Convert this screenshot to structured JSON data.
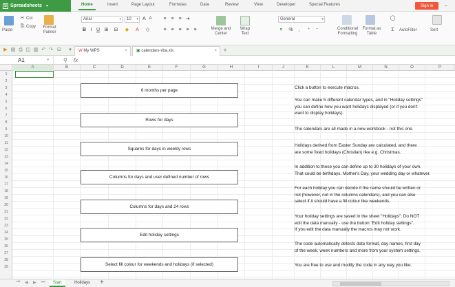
{
  "app": {
    "name": "Spreadsheets"
  },
  "menu": [
    "Home",
    "Insert",
    "Page Layout",
    "Formulas",
    "Data",
    "Review",
    "View",
    "Developer",
    "Special Features"
  ],
  "signin_label": "Sign in",
  "ribbon": {
    "cut": "Cut",
    "paste": "Paste",
    "copy": "Copy",
    "format_painter": "Format Painter",
    "font": "Arial",
    "size": "10",
    "merge": "Merge and Center",
    "wrap": "Wrap Text",
    "number_format": "General",
    "conditional": "Conditional Formatting",
    "format_table": "Format as Table",
    "autofilter": "AutoFilter",
    "sort": "Sort"
  },
  "tabs": {
    "home": "My WPS",
    "file": "calendars-vba.xls"
  },
  "formula": {
    "cell_ref": "A1",
    "fx": "fx"
  },
  "columns": [
    "A",
    "B",
    "C",
    "D",
    "E",
    "F",
    "G",
    "H",
    "I",
    "J",
    "K",
    "L",
    "M",
    "N",
    "O",
    "P"
  ],
  "rows": [
    "1",
    "2",
    "3",
    "4",
    "5",
    "6",
    "7",
    "8",
    "9",
    "10",
    "11",
    "12",
    "13",
    "14",
    "15",
    "16",
    "17",
    "18",
    "19",
    "20",
    "21",
    "22",
    "23",
    "24",
    "25",
    "26",
    "27",
    "28",
    "29"
  ],
  "buttons": [
    "6 months per page",
    "Rows for days",
    "Squares for days in weekly rows",
    "Columns for days and user defined number of rows",
    "Columns for days and 24 rows",
    "Edit holiday settings",
    "Select fill colour for weekends and holidays (if selected)"
  ],
  "info": [
    "Click a button to execute macros.",
    "You can make 5 different calendar types, and in \"Holiday settings\"\nyou can define how you want holidays displayed (or if you don't\nwant to display holidays).",
    "The calendars are all made in a new workbook - not this one.",
    "Holidays derived from Easter Sunday are calculated, and there\nare some fixed holidays (Christian) like e.g. Christmas.",
    "In addition to these you can define up to 30 holidays of your own.\nThat could be birthdays, Mother's Day, your wedding day or whatever.",
    "For each holiday you can decide if the name should be written or\nnot (however, not in the columns calendars), and you can also\nselect if it should have a fill colour like weekends.",
    "Your holiday settings are saved in the sheet \"Holidays\". Do NOT\nedit the data manually - use the button \"Edit holiday settings\".\nIf you edit the data manually the macros may not work.",
    "The code automatically detects date format, day names, first day\nof the week, week numbers and more from your system settings.",
    "You are free to use and modify the code in any way you like."
  ],
  "sheets": [
    "Start",
    "Holidays"
  ]
}
